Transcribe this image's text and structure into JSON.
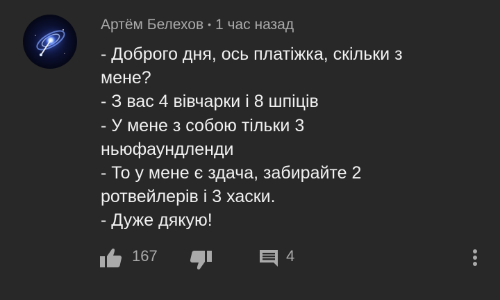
{
  "comment": {
    "author": "Артём Белехов",
    "separator": "•",
    "timestamp": "1 час назад",
    "lines": [
      "- Доброго дня, ось платіжка, скільки з",
      "мене?",
      "- З вас 4 вівчарки і 8 шпіців",
      "- У мене з собою тільки 3",
      "ньюфаундленди",
      "- То у мене є здача, забирайте 2",
      "ротвейлерів і 3 хаски.",
      "- Дуже дякую!"
    ],
    "avatar_icon": "galaxy-avatar"
  },
  "actions": {
    "like_icon": "thumbs-up-icon",
    "like_count": "167",
    "dislike_icon": "thumbs-down-icon",
    "reply_icon": "comment-icon",
    "reply_count": "4",
    "more_icon": "more-vertical-icon"
  },
  "colors": {
    "background": "#282828",
    "text_primary": "#f1f1f1",
    "text_secondary": "#aaaaaa"
  }
}
